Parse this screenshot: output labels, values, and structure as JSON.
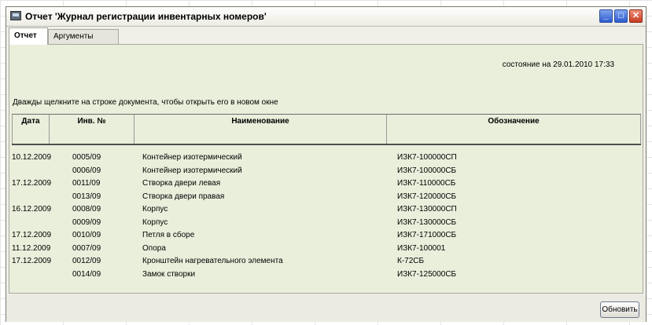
{
  "window": {
    "title": "Отчет 'Журнал регистрации инвентарных номеров'",
    "controls": {
      "minimize": "_",
      "maximize": "□",
      "close": "✕"
    }
  },
  "tabs": [
    {
      "label": "Отчет",
      "active": true
    },
    {
      "label": "Аргументы",
      "active": false
    }
  ],
  "report": {
    "status": "состояние на 29.01.2010 17:33",
    "hint": "Дважды щелкните на строке документа, чтобы открыть его в новом окне",
    "columns": [
      "Дата",
      "Инв. №",
      "Наименование",
      "Обозначение"
    ],
    "rows": [
      {
        "date": "10.12.2009",
        "inv": "0005/09",
        "name": "Контейнер изотермический",
        "designation": "ИЗК7-100000СП"
      },
      {
        "date": "",
        "inv": "0006/09",
        "name": "Контейнер изотермический",
        "designation": "ИЗК7-100000СБ"
      },
      {
        "date": "17.12.2009",
        "inv": "0011/09",
        "name": "Створка двери левая",
        "designation": "ИЗК7-110000СБ"
      },
      {
        "date": "",
        "inv": "0013/09",
        "name": "Створка двери правая",
        "designation": "ИЗК7-120000СБ"
      },
      {
        "date": "16.12.2009",
        "inv": "0008/09",
        "name": "Корпус",
        "designation": "ИЗК7-130000СП"
      },
      {
        "date": "",
        "inv": "0009/09",
        "name": "Корпус",
        "designation": "ИЗК7-130000СБ"
      },
      {
        "date": "17.12.2009",
        "inv": "0010/09",
        "name": "Петля в сборе",
        "designation": "ИЗК7-171000СБ"
      },
      {
        "date": "11.12.2009",
        "inv": "0007/09",
        "name": "Опора",
        "designation": "ИЗК7-100001"
      },
      {
        "date": "17.12.2009",
        "inv": "0012/09",
        "name": "Кронштейн нагревательного элемента",
        "designation": "К-72СБ"
      },
      {
        "date": "",
        "inv": "0014/09",
        "name": "Замок створки",
        "designation": "ИЗК7-125000СБ"
      }
    ]
  },
  "footer": {
    "refresh_label": "Обновить"
  }
}
